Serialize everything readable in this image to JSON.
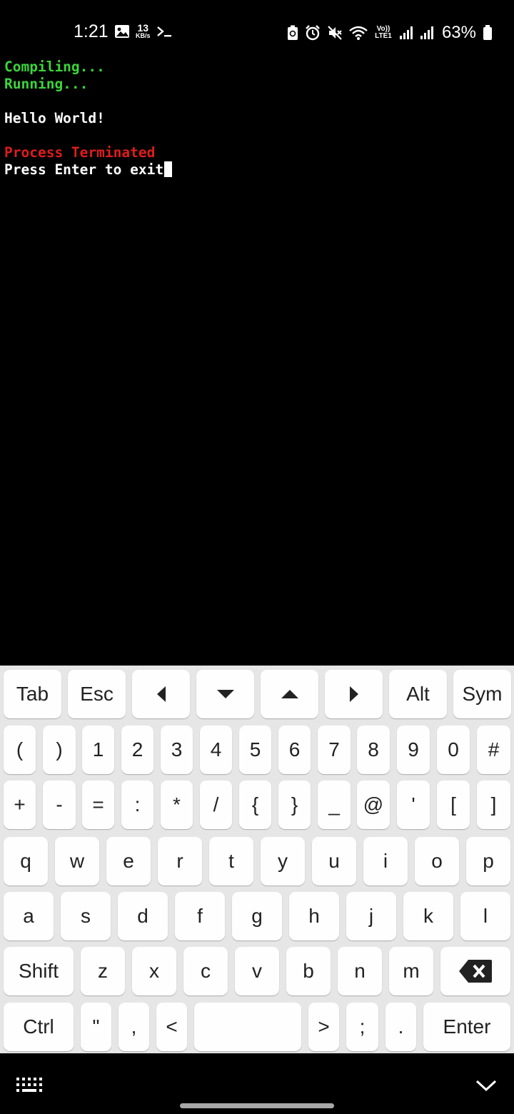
{
  "status_bar": {
    "time": "1:21",
    "network_speed": "13",
    "network_speed_unit": "KB/s",
    "network_type": "Vo)) LTE1",
    "battery_percent": "63%"
  },
  "terminal": {
    "lines": [
      {
        "text": "Compiling...",
        "color": "#3bd53b"
      },
      {
        "text": "Running...",
        "color": "#3bd53b"
      },
      {
        "text": "",
        "color": "#ffffff"
      },
      {
        "text": "Hello World!",
        "color": "#ffffff"
      },
      {
        "text": "",
        "color": "#ffffff"
      },
      {
        "text": "Process Terminated",
        "color": "#e01c1c"
      },
      {
        "text": "Press Enter to exit",
        "color": "#ffffff"
      }
    ]
  },
  "keyboard": {
    "row1": [
      {
        "label": "Tab",
        "icon": null
      },
      {
        "label": "Esc",
        "icon": null
      },
      {
        "label": "",
        "icon": "arrow-left-icon"
      },
      {
        "label": "",
        "icon": "arrow-down-icon"
      },
      {
        "label": "",
        "icon": "arrow-up-icon"
      },
      {
        "label": "",
        "icon": "arrow-right-icon"
      },
      {
        "label": "Alt",
        "icon": null
      },
      {
        "label": "Sym",
        "icon": null
      }
    ],
    "row2": [
      "(",
      ")",
      "1",
      "2",
      "3",
      "4",
      "5",
      "6",
      "7",
      "8",
      "9",
      "0",
      "#"
    ],
    "row3": [
      "+",
      "-",
      "=",
      ":",
      "*",
      "/",
      "{",
      "}",
      "_",
      "@",
      "'",
      "[",
      "]"
    ],
    "row4": [
      "q",
      "w",
      "e",
      "r",
      "t",
      "y",
      "u",
      "i",
      "o",
      "p"
    ],
    "row5": [
      "a",
      "s",
      "d",
      "f",
      "g",
      "h",
      "j",
      "k",
      "l"
    ],
    "row6": [
      "Shift",
      "z",
      "x",
      "c",
      "v",
      "b",
      "n",
      "m",
      ""
    ],
    "row7": [
      "Ctrl",
      "\"",
      ",",
      "<",
      "",
      ">",
      ";",
      ".",
      "Enter"
    ],
    "backspace_icon": "backspace-icon",
    "space_label": ""
  },
  "nav_bar": {
    "keyboard_icon": "keyboard-icon",
    "hide_icon": "chevron-down-icon"
  }
}
